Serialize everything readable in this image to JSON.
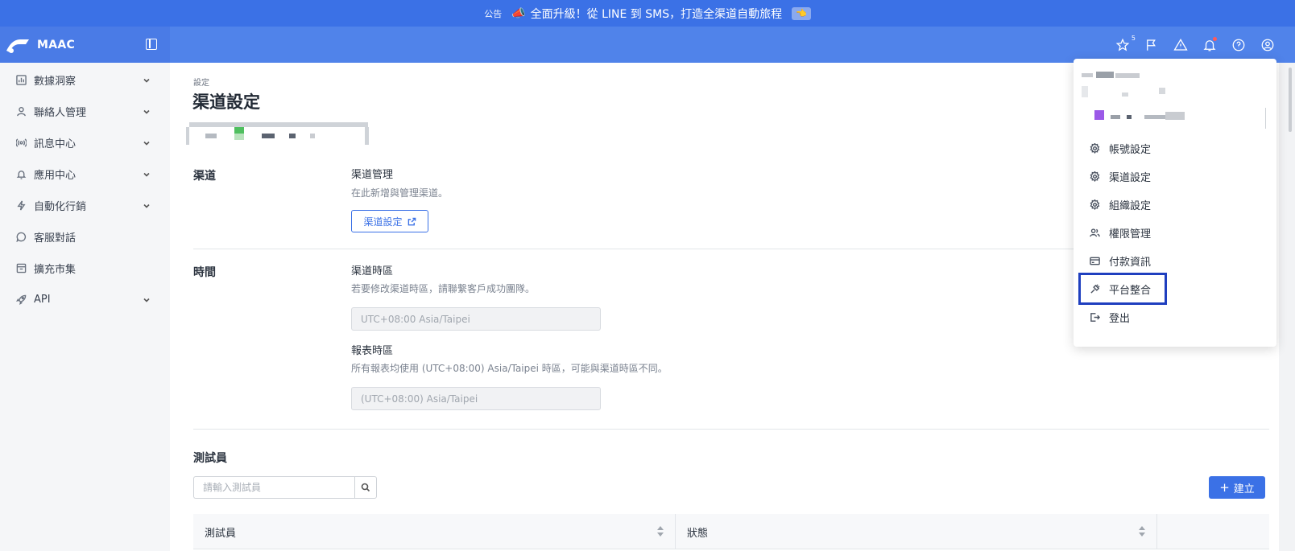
{
  "announcement": {
    "tag": "公告",
    "message": "全面升級！從 LINE 到 SMS，打造全渠道自動旅程",
    "icon": "megaphone-icon",
    "chip_icon": "pointing-hand-icon"
  },
  "header": {
    "brand_name": "MAAC",
    "star_badge": "5",
    "icons": [
      "star-icon",
      "flag-icon",
      "warning-icon",
      "bell-icon",
      "help-icon",
      "account-icon"
    ]
  },
  "sidebar": {
    "items": [
      {
        "label": "數據洞察",
        "icon": "chart-icon",
        "has_chevron": true
      },
      {
        "label": "聯絡人管理",
        "icon": "user-icon",
        "has_chevron": true
      },
      {
        "label": "訊息中心",
        "icon": "broadcast-icon",
        "has_chevron": true
      },
      {
        "label": "應用中心",
        "icon": "bell-icon",
        "has_chevron": true
      },
      {
        "label": "自動化行銷",
        "icon": "lightning-icon",
        "has_chevron": true
      },
      {
        "label": "客服對話",
        "icon": "chat-icon",
        "has_chevron": false
      },
      {
        "label": "擴充市集",
        "icon": "store-icon",
        "has_chevron": false
      },
      {
        "label": "API",
        "icon": "rocket-icon",
        "has_chevron": true
      }
    ]
  },
  "main": {
    "breadcrumb": "設定",
    "title": "渠道設定",
    "channel": {
      "section": "渠道",
      "field_title": "渠道管理",
      "field_desc": "在此新增與管理渠道。",
      "button": "渠道設定"
    },
    "time": {
      "section": "時間",
      "channel_tz_title": "渠道時區",
      "channel_tz_desc": "若要修改渠道時區，請聯繫客戶成功團隊。",
      "channel_tz_value": "UTC+08:00 Asia/Taipei",
      "report_tz_title": "報表時區",
      "report_tz_desc": "所有報表均使用 (UTC+08:00) Asia/Taipei 時區，可能與渠道時區不同。",
      "report_tz_value": "(UTC+08:00) Asia/Taipei"
    },
    "testers": {
      "section": "測試員",
      "search_placeholder": "請輸入測試員",
      "create_label": "建立",
      "columns": [
        "測試員",
        "狀態"
      ]
    }
  },
  "dropdown": {
    "items": [
      {
        "label": "帳號設定",
        "icon": "gear-icon"
      },
      {
        "label": "渠道設定",
        "icon": "gear-icon"
      },
      {
        "label": "組織設定",
        "icon": "gear-icon"
      },
      {
        "label": "權限管理",
        "icon": "users-icon"
      },
      {
        "label": "付款資訊",
        "icon": "card-icon"
      },
      {
        "label": "平台整合",
        "icon": "plug-icon"
      },
      {
        "label": "登出",
        "icon": "logout-icon"
      }
    ],
    "highlighted": "平台整合"
  },
  "colors": {
    "primary": "#3b71e6",
    "header": "#5083ea",
    "highlight_border": "#1f3fbf"
  }
}
